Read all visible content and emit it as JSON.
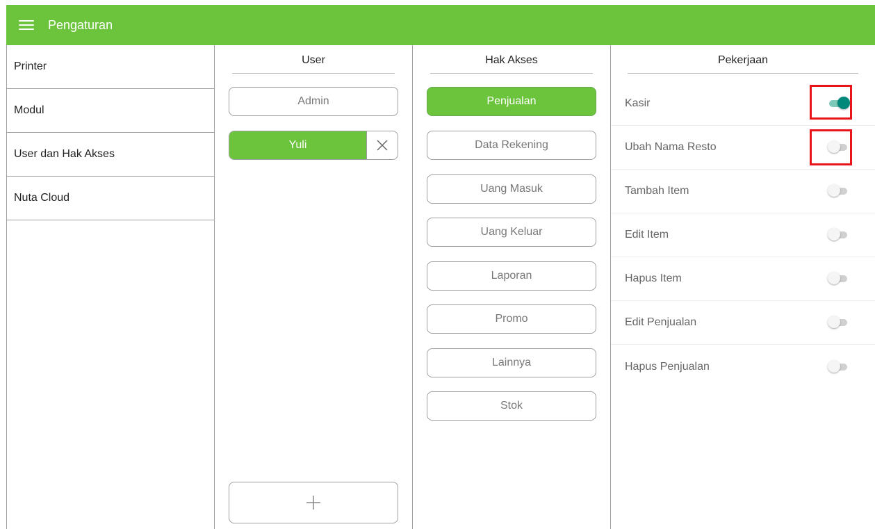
{
  "appbar": {
    "title": "Pengaturan"
  },
  "sidebar": {
    "items": [
      {
        "label": "Printer"
      },
      {
        "label": "Modul"
      },
      {
        "label": "User dan Hak Akses"
      },
      {
        "label": "Nuta Cloud"
      }
    ]
  },
  "user_column": {
    "title": "User",
    "users": [
      {
        "label": "Admin",
        "selected": false
      },
      {
        "label": "Yuli",
        "selected": true
      }
    ],
    "add_icon": "plus-icon",
    "remove_icon": "close-icon"
  },
  "access_column": {
    "title": "Hak Akses",
    "items": [
      {
        "label": "Penjualan",
        "selected": true
      },
      {
        "label": "Data Rekening",
        "selected": false
      },
      {
        "label": "Uang Masuk",
        "selected": false
      },
      {
        "label": "Uang Keluar",
        "selected": false
      },
      {
        "label": "Laporan",
        "selected": false
      },
      {
        "label": "Promo",
        "selected": false
      },
      {
        "label": "Lainnya",
        "selected": false
      },
      {
        "label": "Stok",
        "selected": false
      }
    ]
  },
  "job_column": {
    "title": "Pekerjaan",
    "items": [
      {
        "label": "Kasir",
        "enabled": true,
        "highlighted": true
      },
      {
        "label": "Ubah Nama Resto",
        "enabled": false,
        "highlighted": true
      },
      {
        "label": "Tambah Item",
        "enabled": false,
        "highlighted": false
      },
      {
        "label": "Edit Item",
        "enabled": false,
        "highlighted": false
      },
      {
        "label": "Hapus Item",
        "enabled": false,
        "highlighted": false
      },
      {
        "label": "Edit Penjualan",
        "enabled": false,
        "highlighted": false
      },
      {
        "label": "Hapus Penjualan",
        "enabled": false,
        "highlighted": false
      }
    ]
  },
  "colors": {
    "primary_green": "#6cc43c",
    "toggle_on": "#00897b",
    "highlight": "#e8141a"
  }
}
